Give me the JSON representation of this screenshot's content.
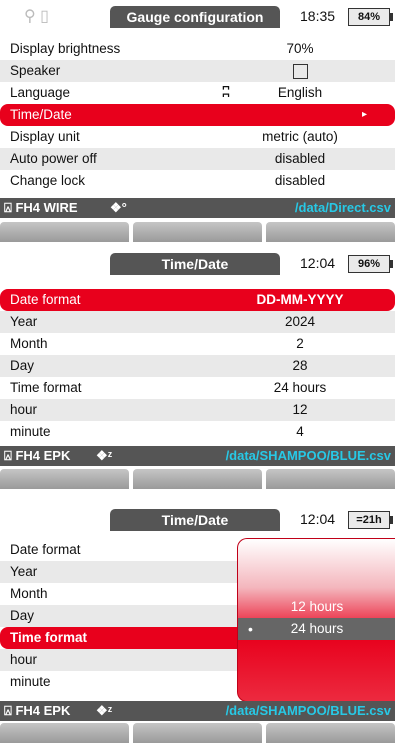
{
  "screen1": {
    "title": "Gauge configuration",
    "time": "18:35",
    "battery": "84%",
    "rows": [
      {
        "label": "Display brightness",
        "value": "70%"
      },
      {
        "label": "Speaker",
        "value": ""
      },
      {
        "label": "Language",
        "value": "English"
      },
      {
        "label": "Time/Date",
        "value": ""
      },
      {
        "label": "Display unit",
        "value": "metric (auto)"
      },
      {
        "label": "Auto power off",
        "value": "disabled"
      },
      {
        "label": "Change lock",
        "value": "disabled"
      }
    ],
    "status_device": "FH4 WIRE",
    "status_path": "/data/Direct.csv"
  },
  "screen2": {
    "title": "Time/Date",
    "time": "12:04",
    "battery": "96%",
    "rows": [
      {
        "label": "Date format",
        "value": "DD-MM-YYYY"
      },
      {
        "label": "Year",
        "value": "2024"
      },
      {
        "label": "Month",
        "value": "2"
      },
      {
        "label": "Day",
        "value": "28"
      },
      {
        "label": "Time format",
        "value": "24 hours"
      },
      {
        "label": "hour",
        "value": "12"
      },
      {
        "label": "minute",
        "value": "4"
      }
    ],
    "status_device": "FH4 EPK",
    "status_path": "/data/SHAMPOO/BLUE.csv"
  },
  "screen3": {
    "title": "Time/Date",
    "time": "12:04",
    "battery": "=21h",
    "rows": [
      {
        "label": "Date format"
      },
      {
        "label": "Year"
      },
      {
        "label": "Month"
      },
      {
        "label": "Day"
      },
      {
        "label": "Time format"
      },
      {
        "label": "hour"
      },
      {
        "label": "minute"
      }
    ],
    "options": [
      "12 hours",
      "24 hours"
    ],
    "status_device": "FH4 EPK",
    "status_path": "/data/SHAMPOO/BLUE.csv"
  },
  "colors": {
    "accent": "#e8001c",
    "path": "#27c9e6",
    "statusbar": "#555555"
  }
}
